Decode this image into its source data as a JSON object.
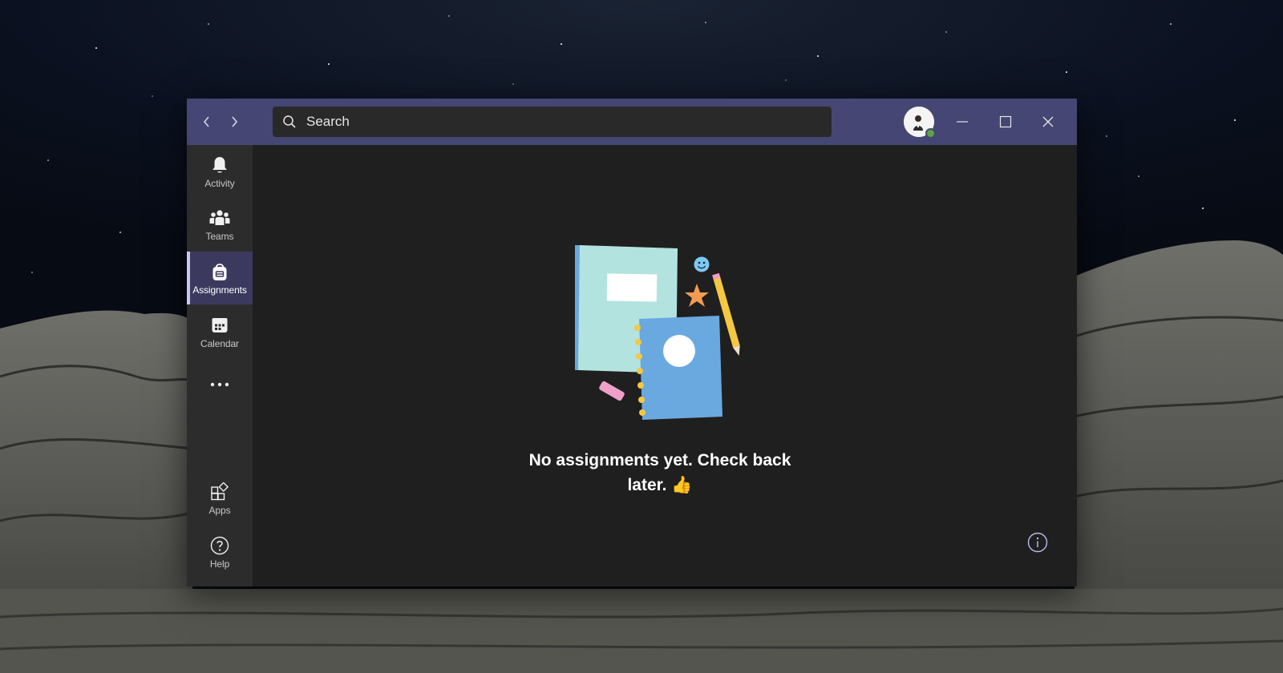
{
  "search": {
    "placeholder": "Search"
  },
  "rail": {
    "items": [
      {
        "label": "Activity",
        "icon": "bell-icon"
      },
      {
        "label": "Teams",
        "icon": "teams-icon"
      },
      {
        "label": "Assignments",
        "icon": "backpack-icon",
        "active": true
      },
      {
        "label": "Calendar",
        "icon": "calendar-icon"
      },
      {
        "label": "",
        "icon": "more-icon"
      }
    ],
    "bottom_items": [
      {
        "label": "Apps",
        "icon": "apps-icon"
      },
      {
        "label": "Help",
        "icon": "help-icon"
      }
    ]
  },
  "main": {
    "empty_line1": "No assignments yet. Check back",
    "empty_line2": "later.",
    "emoji": "👍"
  },
  "colors": {
    "titlebar": "#454673",
    "rail": "#2d2c2c",
    "active_rail": "#3b3a5e",
    "content_bg": "#1f1f1f",
    "accent": "#c7c8f0",
    "presence": "#5ba643"
  }
}
